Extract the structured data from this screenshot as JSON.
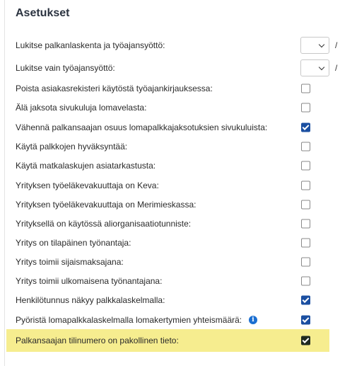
{
  "title": "Asetukset",
  "colors": {
    "checkbox_checked": "#1b4fa1",
    "highlight": "#f6ed8f",
    "info_icon": "#1b6fd1"
  },
  "settings": [
    {
      "label": "Lukitse palkanlaskenta ja työajansyöttö:",
      "control": "select",
      "value": "",
      "suffix": "/"
    },
    {
      "label": "Lukitse vain työajansyöttö:",
      "control": "select",
      "value": "",
      "suffix": "/"
    },
    {
      "label": "Poista asiakasrekisteri käytöstä työajankirjauksessa:",
      "control": "checkbox",
      "checked": false
    },
    {
      "label": "Älä jaksota sivukuluja lomavelasta:",
      "control": "checkbox",
      "checked": false
    },
    {
      "label": "Vähennä palkansaajan osuus lomapalkkajaksotuksien sivukuluista:",
      "control": "checkbox",
      "checked": true
    },
    {
      "label": "Käytä palkkojen hyväksyntää:",
      "control": "checkbox",
      "checked": false
    },
    {
      "label": "Käytä matkalaskujen asiatarkastusta:",
      "control": "checkbox",
      "checked": false
    },
    {
      "label": "Yrityksen työeläkevakuuttaja on Keva:",
      "control": "checkbox",
      "checked": false
    },
    {
      "label": "Yrityksen työeläkevakuuttaja on Merimieskassa:",
      "control": "checkbox",
      "checked": false
    },
    {
      "label": "Yrityksellä on käytössä aliorganisaatiotunniste:",
      "control": "checkbox",
      "checked": false
    },
    {
      "label": "Yritys on tilapäinen työnantaja:",
      "control": "checkbox",
      "checked": false
    },
    {
      "label": "Yritys toimii sijaismaksajana:",
      "control": "checkbox",
      "checked": false
    },
    {
      "label": "Yritys toimii ulkomaisena työnantajana:",
      "control": "checkbox",
      "checked": false
    },
    {
      "label": "Henkilötunnus näkyy palkkalaskelmalla:",
      "control": "checkbox",
      "checked": true
    },
    {
      "label": "Pyöristä lomapalkkalaskelmalla lomakertymien yhteismäärä:",
      "control": "checkbox",
      "checked": true,
      "info_icon": "i"
    },
    {
      "label": "Palkansaajan tilinumero on pakollinen tieto:",
      "control": "checkbox",
      "checked": true,
      "highlighted": true
    }
  ]
}
